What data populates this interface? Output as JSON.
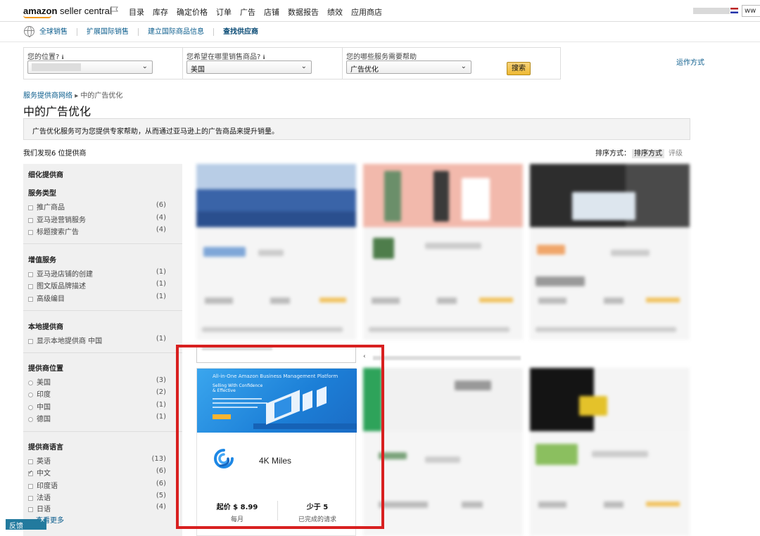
{
  "header": {
    "logo_bold": "amazon",
    "logo_text": "seller central",
    "nav_items": [
      "目录",
      "库存",
      "确定价格",
      "订单",
      "广告",
      "店铺",
      "数据报告",
      "绩效",
      "应用商店"
    ],
    "url_fragment": "ww"
  },
  "subnav": {
    "links": [
      "全球销售",
      "扩展国际销售",
      "建立国际商品信息",
      "查找供应商"
    ]
  },
  "search": {
    "location_label": "您的位置?",
    "location_value": "",
    "market_label": "您希望在哪里销售商品?",
    "market_value": "美国",
    "service_label": "您的哪些服务需要帮助",
    "service_value": "广告优化",
    "search_button": "搜索",
    "how_it_works": "运作方式"
  },
  "breadcrumb": {
    "root": "服务提供商网络",
    "separator": "▸",
    "current": "中的广告优化"
  },
  "page_title": "中的广告优化",
  "info_text": "广告优化服务可为您提供专家帮助，从而通过亚马逊上的广告商品来提升销量。",
  "results_text": "我们发现6 位提供商",
  "sort": {
    "label": "排序方式：",
    "option1": "排序方式",
    "option2": "评级"
  },
  "sidebar": {
    "heading": "细化提供商",
    "service_type": {
      "title": "服务类型",
      "items": [
        {
          "label": "推广商品",
          "count": "(6)"
        },
        {
          "label": "亚马逊营销服务",
          "count": "(4)"
        },
        {
          "label": "标题搜索广告",
          "count": "(4)"
        }
      ]
    },
    "value_added": {
      "title": "增值服务",
      "items": [
        {
          "label": "亚马逊店铺的创建",
          "count": "(1)"
        },
        {
          "label": "图文版品牌描述",
          "count": "(1)"
        },
        {
          "label": "高级编目",
          "count": "(1)"
        }
      ]
    },
    "local": {
      "title": "本地提供商",
      "items": [
        {
          "label": "显示本地提供商 中国",
          "count": "(1)"
        }
      ]
    },
    "provider_location": {
      "title": "提供商位置",
      "items": [
        {
          "label": "美国",
          "count": "(3)"
        },
        {
          "label": "印度",
          "count": "(2)"
        },
        {
          "label": "中国",
          "count": "(1)"
        },
        {
          "label": "德国",
          "count": "(1)"
        }
      ]
    },
    "provider_language": {
      "title": "提供商语言",
      "items": [
        {
          "label": "英语",
          "count": "(13)"
        },
        {
          "label": "中文",
          "count": "(6)",
          "checked": true
        },
        {
          "label": "印度语",
          "count": "(6)"
        },
        {
          "label": "法语",
          "count": "(5)"
        },
        {
          "label": "日语",
          "count": "(4)"
        }
      ],
      "more": "查看更多"
    }
  },
  "featured_card": {
    "banner_title": "All-in-One Amazon Business Management Platform",
    "banner_line1": "Selling With Confidence",
    "banner_line2": "& Effective",
    "name": "4K Miles",
    "price": "起价 $ 8.99",
    "price_sub": "每月",
    "requests": "少于 5",
    "requests_sub": "已完成的请求"
  },
  "feedback": {
    "label": "反馈",
    "close": "×"
  },
  "colors": {
    "highlight": "#d82020",
    "link": "#0a5c8c",
    "banner": "#1c7fd7",
    "button": "#eeb933"
  }
}
